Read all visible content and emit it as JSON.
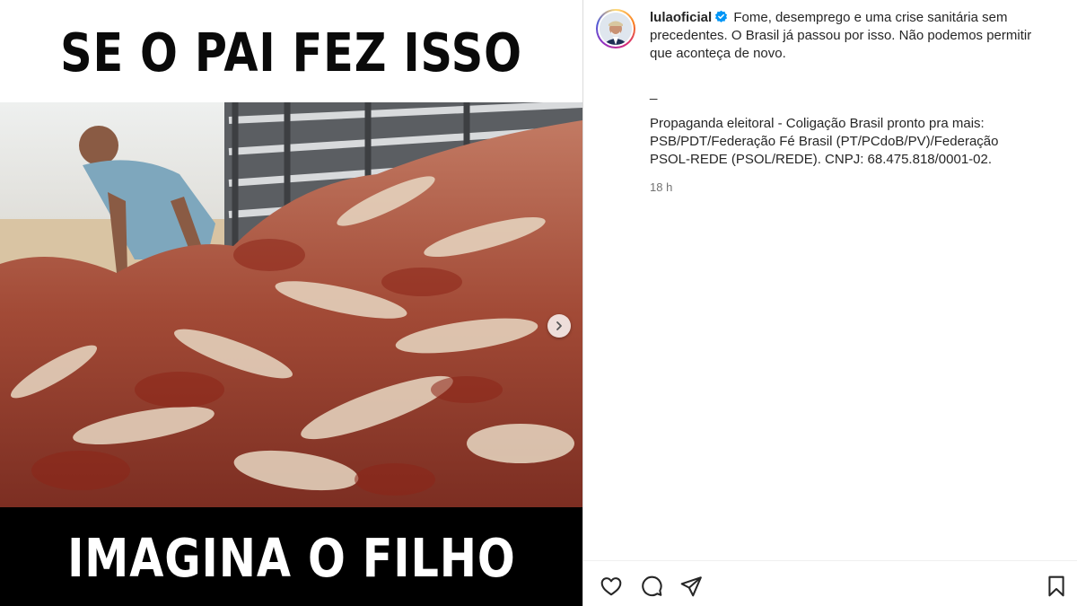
{
  "meme": {
    "top_text": "SE O PAI FEZ ISSO",
    "bottom_text": "IMAGINA O FILHO"
  },
  "media": {
    "next_icon": "chevron-right-icon"
  },
  "post": {
    "username": "lulaoficial",
    "verified_icon": "verified-badge-icon",
    "caption": "Fome, desemprego e uma crise sanitária sem precedentes. O Brasil já passou por isso. Não podemos permitir que aconteça de novo.",
    "separator": "_",
    "legal_text": "Propaganda eleitoral - Coligação Brasil pronto pra mais: PSB/PDT/Federação Fé Brasil (PT/PCdoB/PV)/Federação PSOL-REDE (PSOL/REDE). CNPJ: 68.475.818/0001-02.",
    "time": "18 h"
  },
  "actions": {
    "like_icon": "heart-icon",
    "comment_icon": "comment-icon",
    "share_icon": "send-icon",
    "save_icon": "bookmark-icon"
  },
  "colors": {
    "text": "#262626",
    "muted": "#737373",
    "verified": "#0095f6",
    "divider": "#dbdbdb"
  }
}
